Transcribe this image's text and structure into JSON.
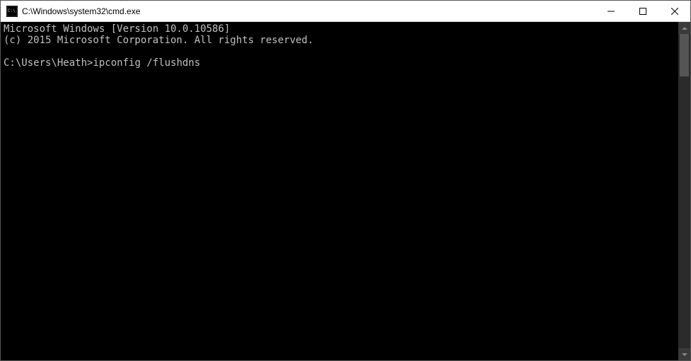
{
  "titlebar": {
    "title": "C:\\Windows\\system32\\cmd.exe"
  },
  "console": {
    "line1": "Microsoft Windows [Version 10.0.10586]",
    "line2": "(c) 2015 Microsoft Corporation. All rights reserved.",
    "blank": "",
    "prompt": "C:\\Users\\Heath>",
    "command": "ipconfig /flushdns"
  }
}
